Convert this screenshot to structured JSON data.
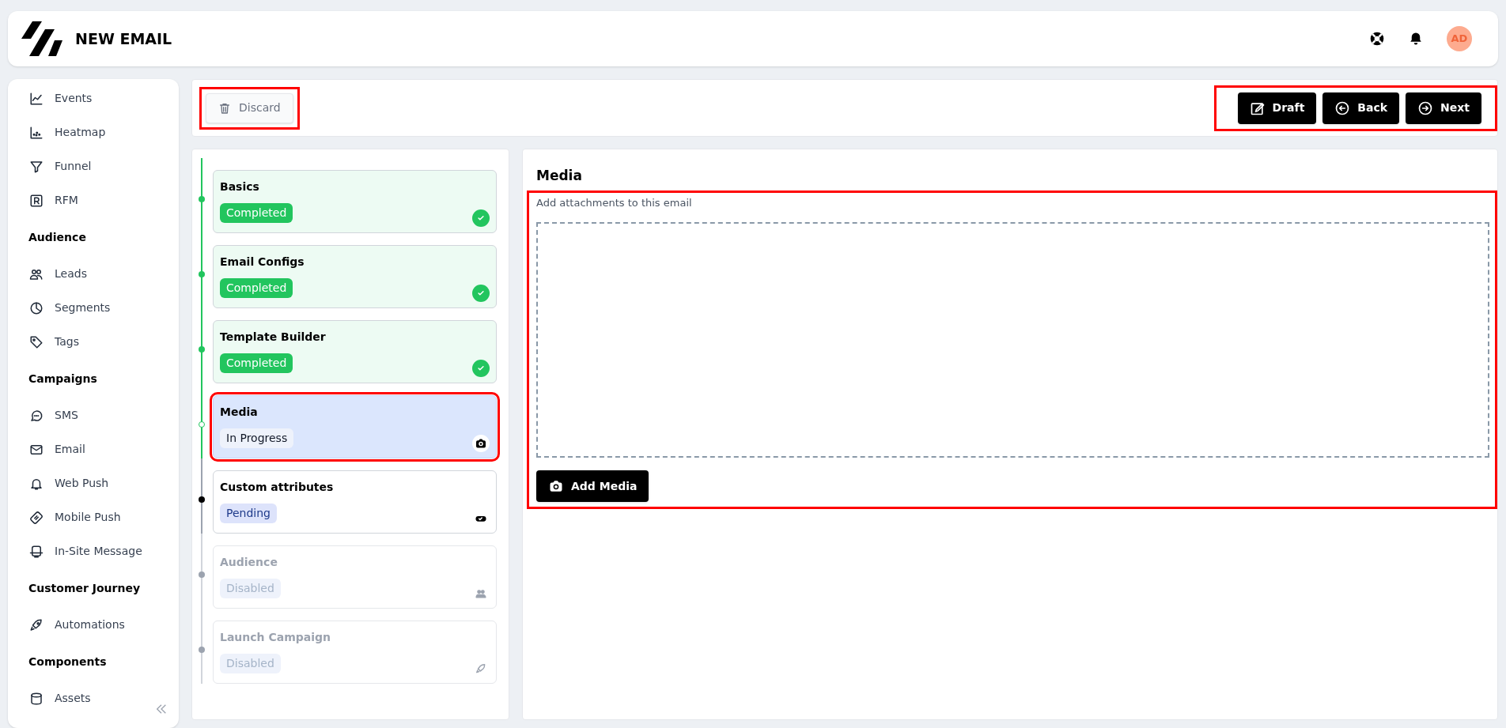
{
  "header": {
    "title": "NEW EMAIL",
    "avatar": "AD"
  },
  "sidebar": {
    "sections": [
      {
        "items": [
          "Events",
          "Heatmap",
          "Funnel",
          "RFM"
        ]
      },
      {
        "heading": "Audience",
        "items": [
          "Leads",
          "Segments",
          "Tags"
        ]
      },
      {
        "heading": "Campaigns",
        "items": [
          "SMS",
          "Email",
          "Web Push",
          "Mobile Push",
          "In-Site Message"
        ]
      },
      {
        "heading": "Customer Journey",
        "items": [
          "Automations"
        ]
      },
      {
        "heading": "Components",
        "items": [
          "Assets"
        ]
      }
    ]
  },
  "toolbar": {
    "discard": "Discard",
    "buttons": [
      "Draft",
      "Back",
      "Next"
    ]
  },
  "steps": [
    {
      "title": "Basics",
      "status": "Completed",
      "kind": "completed",
      "selected": false
    },
    {
      "title": "Email Configs",
      "status": "Completed",
      "kind": "completed",
      "selected": false
    },
    {
      "title": "Template Builder",
      "status": "Completed",
      "kind": "completed",
      "selected": false
    },
    {
      "title": "Media",
      "status": "In Progress",
      "kind": "in_progress",
      "selected": true
    },
    {
      "title": "Custom attributes",
      "status": "Pending",
      "kind": "pending",
      "selected": false
    },
    {
      "title": "Audience",
      "status": "Disabled",
      "kind": "disabled",
      "selected": false
    },
    {
      "title": "Launch Campaign",
      "status": "Disabled",
      "kind": "disabled",
      "selected": false
    }
  ],
  "content": {
    "title": "Media",
    "subtitle": "Add attachments to this email",
    "button": "Add Media"
  }
}
